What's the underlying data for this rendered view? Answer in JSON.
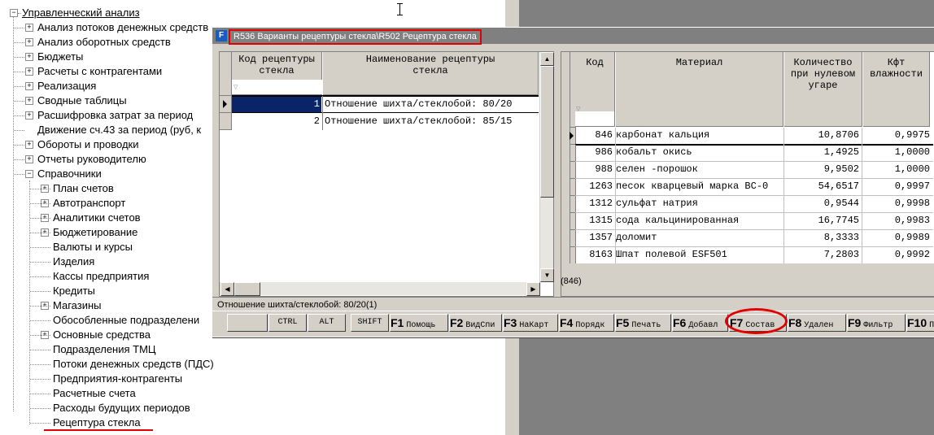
{
  "tree": {
    "root": "Управленческий анализ",
    "items": [
      "Анализ потоков денежных средств",
      "Анализ оборотных средств",
      "Бюджеты",
      "Расчеты с контрагентами",
      "Реализация",
      "Сводные таблицы",
      "Расшифровка затрат за период",
      "Движение сч.43 за период (руб, к",
      "Обороты и проводки",
      "Отчеты руководителю",
      "Справочники"
    ],
    "subitems": [
      "План счетов",
      "Автотранспорт",
      "Аналитики счетов",
      "Бюджетирование",
      "Валюты и курсы",
      "Изделия",
      "Кассы предприятия",
      "Кредиты",
      "Магазины",
      "Обособленные подразделени",
      "Основные средства",
      "Подразделения ТМЦ",
      "Потоки денежных средств (ПДС)",
      "Предприятия-контрагенты",
      "Расчетные счета",
      "Расходы будущих периодов",
      "Рецептура стекла"
    ]
  },
  "dialog": {
    "title": "R536 Варианты рецептуры стекла\\R502 Рецептура стекла",
    "left_grid": {
      "headers": [
        "Код рецептуры стекла",
        "Наименование рецептуры стекла"
      ],
      "rows": [
        {
          "code": "1",
          "name": "Отношение шихта/стеклобой: 80/20"
        },
        {
          "code": "2",
          "name": "Отношение шихта/стеклобой: 85/15"
        }
      ]
    },
    "right_grid": {
      "headers": [
        "Код",
        "Материал",
        "Количество при нулевом угаре",
        "Кфт влажности"
      ],
      "rows": [
        {
          "code": "846",
          "material": "карбонат кальция",
          "qty": "10,8706",
          "kft": "0,9975"
        },
        {
          "code": "986",
          "material": "кобальт окись",
          "qty": "1,4925",
          "kft": "1,0000"
        },
        {
          "code": "988",
          "material": "селен -порошок",
          "qty": "9,9502",
          "kft": "1,0000"
        },
        {
          "code": "1263",
          "material": "песок кварцевый марка ВС-0",
          "qty": "54,6517",
          "kft": "0,9997"
        },
        {
          "code": "1312",
          "material": "сульфат натрия",
          "qty": "0,9544",
          "kft": "0,9998"
        },
        {
          "code": "1315",
          "material": "сода кальцинированная",
          "qty": "16,7745",
          "kft": "0,9983"
        },
        {
          "code": "1357",
          "material": "доломит",
          "qty": "8,3333",
          "kft": "0,9989"
        },
        {
          "code": "8163",
          "material": "Шпат полевой ESF501",
          "qty": "7,2803",
          "kft": "0,9992"
        }
      ]
    },
    "right_status": "(846)",
    "status_text": "Отношение шихта/стеклобой: 80/20(1)",
    "modifiers": [
      "CTRL",
      "ALT",
      "SHIFT"
    ],
    "fkeys": [
      {
        "key": "F1",
        "label": "Помощь"
      },
      {
        "key": "F2",
        "label": "ВидСпи"
      },
      {
        "key": "F3",
        "label": "НаКарт"
      },
      {
        "key": "F4",
        "label": "Порядк"
      },
      {
        "key": "F5",
        "label": "Печать"
      },
      {
        "key": "F6",
        "label": "Добавл"
      },
      {
        "key": "F7",
        "label": "Состав"
      },
      {
        "key": "F8",
        "label": "Удален"
      },
      {
        "key": "F9",
        "label": "Фильтр"
      },
      {
        "key": "F10",
        "label": "Поис"
      }
    ]
  },
  "colors": {
    "highlight": "#0a246a",
    "annotation": "#e00000",
    "window": "#d4d0c8"
  }
}
